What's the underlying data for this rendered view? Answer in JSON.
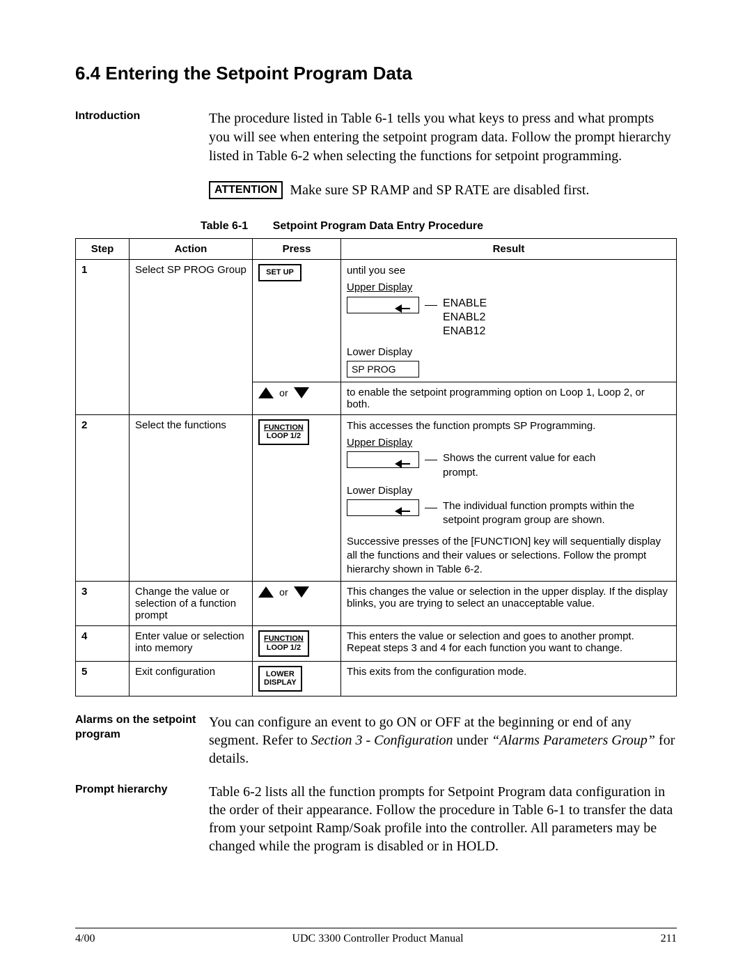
{
  "title": "6.4  Entering the Setpoint Program Data",
  "intro": {
    "label": "Introduction",
    "text": "The procedure listed in Table 6-1 tells you what keys to press and what prompts you will see when entering the setpoint program data. Follow the prompt hierarchy listed in Table 6-2 when selecting the functions for setpoint programming."
  },
  "attention": {
    "box": "ATTENTION",
    "text": "Make sure SP RAMP and SP RATE are disabled first."
  },
  "table": {
    "caption_left": "Table 6-1",
    "caption_right": "Setpoint Program Data Entry Procedure",
    "headers": {
      "step": "Step",
      "action": "Action",
      "press": "Press",
      "result": "Result"
    },
    "keys": {
      "setup": "SET UP",
      "function": "FUNCTION",
      "loop": "LOOP 1/2",
      "lower": "LOWER",
      "display": "DISPLAY",
      "or": "or"
    },
    "row1": {
      "step": "1",
      "action": "Select SP PROG Group",
      "result_intro": "until you see",
      "upper_label": "Upper Display",
      "lower_label": "Lower Display",
      "lower_value": "SP PROG",
      "enable1": "ENABLE",
      "enable2": "ENABL2",
      "enable3": "ENAB12"
    },
    "row1b": {
      "result": "to enable the setpoint programming option on Loop 1, Loop 2, or both."
    },
    "row2": {
      "step": "2",
      "action": "Select the functions",
      "line1": "This accesses the function prompts SP Programming.",
      "upper_label": "Upper Display",
      "upper_note": "Shows the current value for each prompt.",
      "lower_label": "Lower Display",
      "lower_note": "The individual function prompts within the setpoint program group are shown.",
      "para2": "Successive presses of the [FUNCTION] key will sequentially display all the functions and their values or selections. Follow the prompt hierarchy shown in Table 6-2."
    },
    "row3": {
      "step": "3",
      "action": "Change the value or selection of a function prompt",
      "result": "This changes the value or selection in the upper display. If the display blinks, you are trying to select an unacceptable value."
    },
    "row4": {
      "step": "4",
      "action": "Enter value or selection into memory",
      "result": "This enters the value or selection and goes to another prompt. Repeat steps 3 and 4 for each function you want to change."
    },
    "row5": {
      "step": "5",
      "action": "Exit configuration",
      "result": "This exits from the configuration mode."
    }
  },
  "alarms": {
    "label": "Alarms on the setpoint program",
    "text_a": "You can configure an event to go ON or OFF at the beginning or end of any segment. Refer to ",
    "text_b": "Section 3 - Configuration",
    "text_c": " under ",
    "text_d": "“Alarms Parameters Group”",
    "text_e": " for details."
  },
  "hierarchy": {
    "label": "Prompt hierarchy",
    "text": "Table 6-2 lists all the function prompts for Setpoint Program data configuration in the order of their appearance. Follow the procedure in Table 6-1 to transfer the data from your setpoint Ramp/Soak profile into the controller. All parameters may be changed while the program is disabled or in HOLD."
  },
  "footer": {
    "left": "4/00",
    "center": "UDC 3300 Controller Product Manual",
    "right": "211"
  }
}
